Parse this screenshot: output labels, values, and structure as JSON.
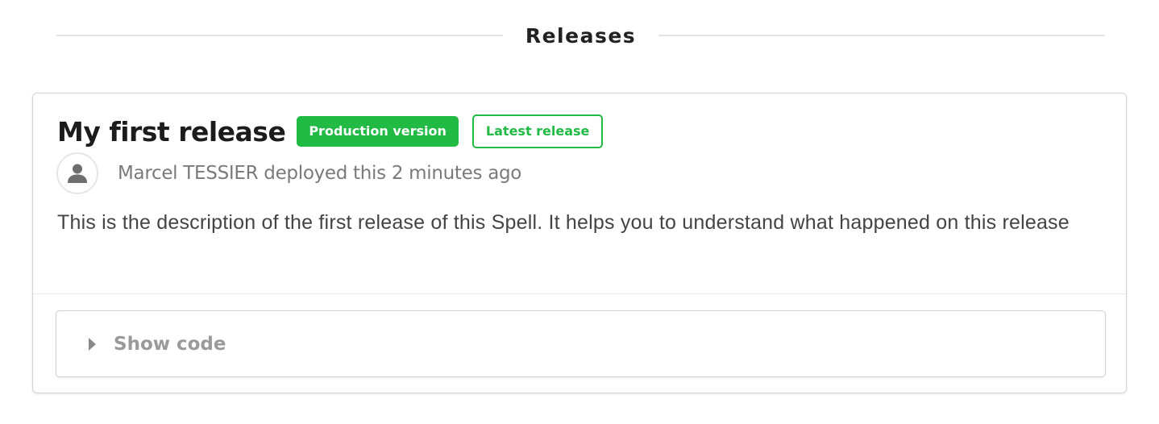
{
  "section": {
    "title": "Releases"
  },
  "release": {
    "title": "My first release",
    "badges": {
      "production": "Production version",
      "latest": "Latest release"
    },
    "author_line": "Marcel TESSIER deployed this 2 minutes ago",
    "description": "This is the description of the first release of this Spell. It helps you to understand what happened on this release",
    "code_toggle_label": "Show code"
  },
  "icons": {
    "avatar": "user-icon",
    "toggle": "caret-right-icon"
  },
  "colors": {
    "accent_green": "#21ba45",
    "muted_text": "#7a7a7a",
    "border": "#d4d4d4"
  }
}
